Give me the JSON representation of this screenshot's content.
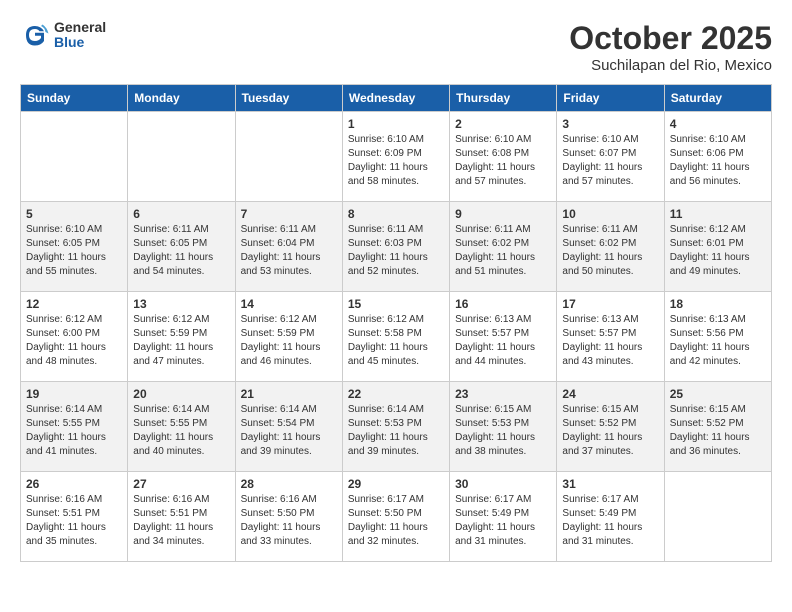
{
  "header": {
    "logo_general": "General",
    "logo_blue": "Blue",
    "month": "October 2025",
    "location": "Suchilapan del Rio, Mexico"
  },
  "weekdays": [
    "Sunday",
    "Monday",
    "Tuesday",
    "Wednesday",
    "Thursday",
    "Friday",
    "Saturday"
  ],
  "weeks": [
    [
      {
        "day": "",
        "info": ""
      },
      {
        "day": "",
        "info": ""
      },
      {
        "day": "",
        "info": ""
      },
      {
        "day": "1",
        "info": "Sunrise: 6:10 AM\nSunset: 6:09 PM\nDaylight: 11 hours and 58 minutes."
      },
      {
        "day": "2",
        "info": "Sunrise: 6:10 AM\nSunset: 6:08 PM\nDaylight: 11 hours and 57 minutes."
      },
      {
        "day": "3",
        "info": "Sunrise: 6:10 AM\nSunset: 6:07 PM\nDaylight: 11 hours and 57 minutes."
      },
      {
        "day": "4",
        "info": "Sunrise: 6:10 AM\nSunset: 6:06 PM\nDaylight: 11 hours and 56 minutes."
      }
    ],
    [
      {
        "day": "5",
        "info": "Sunrise: 6:10 AM\nSunset: 6:05 PM\nDaylight: 11 hours and 55 minutes."
      },
      {
        "day": "6",
        "info": "Sunrise: 6:11 AM\nSunset: 6:05 PM\nDaylight: 11 hours and 54 minutes."
      },
      {
        "day": "7",
        "info": "Sunrise: 6:11 AM\nSunset: 6:04 PM\nDaylight: 11 hours and 53 minutes."
      },
      {
        "day": "8",
        "info": "Sunrise: 6:11 AM\nSunset: 6:03 PM\nDaylight: 11 hours and 52 minutes."
      },
      {
        "day": "9",
        "info": "Sunrise: 6:11 AM\nSunset: 6:02 PM\nDaylight: 11 hours and 51 minutes."
      },
      {
        "day": "10",
        "info": "Sunrise: 6:11 AM\nSunset: 6:02 PM\nDaylight: 11 hours and 50 minutes."
      },
      {
        "day": "11",
        "info": "Sunrise: 6:12 AM\nSunset: 6:01 PM\nDaylight: 11 hours and 49 minutes."
      }
    ],
    [
      {
        "day": "12",
        "info": "Sunrise: 6:12 AM\nSunset: 6:00 PM\nDaylight: 11 hours and 48 minutes."
      },
      {
        "day": "13",
        "info": "Sunrise: 6:12 AM\nSunset: 5:59 PM\nDaylight: 11 hours and 47 minutes."
      },
      {
        "day": "14",
        "info": "Sunrise: 6:12 AM\nSunset: 5:59 PM\nDaylight: 11 hours and 46 minutes."
      },
      {
        "day": "15",
        "info": "Sunrise: 6:12 AM\nSunset: 5:58 PM\nDaylight: 11 hours and 45 minutes."
      },
      {
        "day": "16",
        "info": "Sunrise: 6:13 AM\nSunset: 5:57 PM\nDaylight: 11 hours and 44 minutes."
      },
      {
        "day": "17",
        "info": "Sunrise: 6:13 AM\nSunset: 5:57 PM\nDaylight: 11 hours and 43 minutes."
      },
      {
        "day": "18",
        "info": "Sunrise: 6:13 AM\nSunset: 5:56 PM\nDaylight: 11 hours and 42 minutes."
      }
    ],
    [
      {
        "day": "19",
        "info": "Sunrise: 6:14 AM\nSunset: 5:55 PM\nDaylight: 11 hours and 41 minutes."
      },
      {
        "day": "20",
        "info": "Sunrise: 6:14 AM\nSunset: 5:55 PM\nDaylight: 11 hours and 40 minutes."
      },
      {
        "day": "21",
        "info": "Sunrise: 6:14 AM\nSunset: 5:54 PM\nDaylight: 11 hours and 39 minutes."
      },
      {
        "day": "22",
        "info": "Sunrise: 6:14 AM\nSunset: 5:53 PM\nDaylight: 11 hours and 39 minutes."
      },
      {
        "day": "23",
        "info": "Sunrise: 6:15 AM\nSunset: 5:53 PM\nDaylight: 11 hours and 38 minutes."
      },
      {
        "day": "24",
        "info": "Sunrise: 6:15 AM\nSunset: 5:52 PM\nDaylight: 11 hours and 37 minutes."
      },
      {
        "day": "25",
        "info": "Sunrise: 6:15 AM\nSunset: 5:52 PM\nDaylight: 11 hours and 36 minutes."
      }
    ],
    [
      {
        "day": "26",
        "info": "Sunrise: 6:16 AM\nSunset: 5:51 PM\nDaylight: 11 hours and 35 minutes."
      },
      {
        "day": "27",
        "info": "Sunrise: 6:16 AM\nSunset: 5:51 PM\nDaylight: 11 hours and 34 minutes."
      },
      {
        "day": "28",
        "info": "Sunrise: 6:16 AM\nSunset: 5:50 PM\nDaylight: 11 hours and 33 minutes."
      },
      {
        "day": "29",
        "info": "Sunrise: 6:17 AM\nSunset: 5:50 PM\nDaylight: 11 hours and 32 minutes."
      },
      {
        "day": "30",
        "info": "Sunrise: 6:17 AM\nSunset: 5:49 PM\nDaylight: 11 hours and 31 minutes."
      },
      {
        "day": "31",
        "info": "Sunrise: 6:17 AM\nSunset: 5:49 PM\nDaylight: 11 hours and 31 minutes."
      },
      {
        "day": "",
        "info": ""
      }
    ]
  ]
}
